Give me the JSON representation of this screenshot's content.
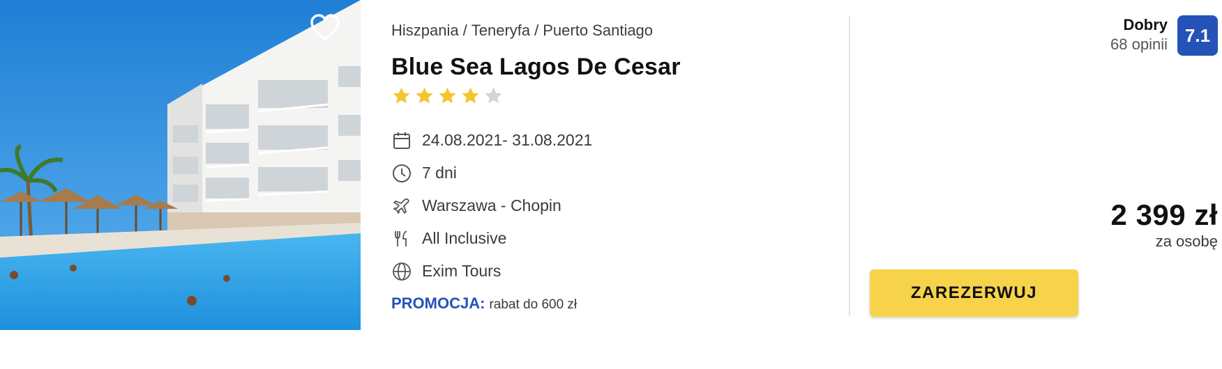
{
  "offer": {
    "breadcrumb": [
      "Hiszpania",
      "Teneryfa",
      "Puerto Santiago"
    ],
    "breadcrumb_separator": "/",
    "title": "Blue Sea Lagos De Cesar",
    "stars": {
      "filled": 4,
      "total": 5
    },
    "dates": "24.08.2021- 31.08.2021",
    "duration": "7 dni",
    "departure": "Warszawa - Chopin",
    "board": "All Inclusive",
    "operator": "Exim Tours",
    "promo_label": "PROMOCJA:",
    "promo_text": "rabat do 600 zł"
  },
  "rating": {
    "word": "Dobry",
    "count": "68 opinii",
    "score": "7.1"
  },
  "price": {
    "value": "2 399 zł",
    "per": "za osobę"
  },
  "cta": {
    "label": "ZAREZERWUJ"
  },
  "icons": {
    "favorite": "heart-outline-icon",
    "dates": "calendar-icon",
    "duration": "clock-icon",
    "departure": "plane-icon",
    "board": "cutlery-icon",
    "operator": "globe-icon"
  },
  "colors": {
    "accent_blue": "#2452b8",
    "star_filled": "#f5c531",
    "star_empty": "#d4d4d4",
    "cta_bg": "#f6d34a"
  }
}
